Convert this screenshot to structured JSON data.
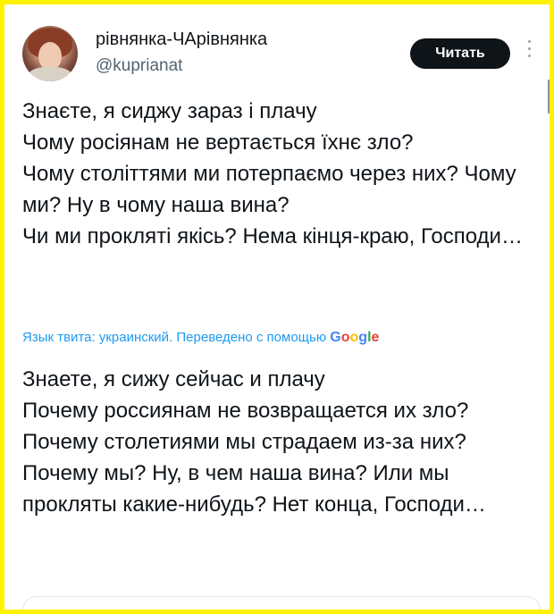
{
  "colors": {
    "frame_border": "#fff200",
    "text": "#0f1419",
    "secondary": "#536471",
    "link": "#1d9bf0",
    "button_bg": "#0f1419",
    "button_text": "#ffffff"
  },
  "tweet": {
    "author": {
      "display_name": "рівнянка-ЧАрівнянка",
      "handle": "@kuprianat",
      "avatar_icon": "user-avatar-photo"
    },
    "follow_button_label": "Читать",
    "more_icon": "vertical-ellipsis-icon",
    "original_text": "Знаєте, я сиджу зараз і плачу\nЧому росіянам не вертається їхнє зло?\nЧому століттями ми потерпаємо через них? Чому ми? Ну в чому наша вина?\nЧи ми прокляті якісь? Нема кінця-краю, Господи…",
    "translation_notice": "Язык твита: украинский. Переведено с помощью",
    "translation_provider": {
      "g1": "G",
      "o1": "o",
      "o2": "o",
      "g2": "g",
      "l": "l",
      "e": "e"
    },
    "translated_text": "Знаете, я сижу сейчас и плачу\nПочему россиянам не возвращается их зло? Почему столетиями мы страдаем из-за них? Почему мы? Ну, в чем наша вина? Или мы прокляты какие-нибудь? Нет конца, Господи…"
  }
}
